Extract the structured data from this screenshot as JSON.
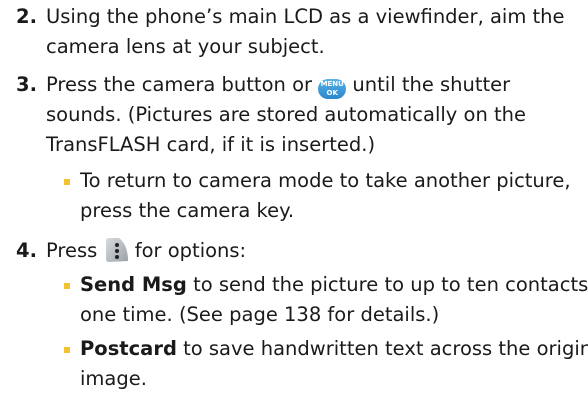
{
  "steps": [
    {
      "number": "2.",
      "lines": [
        "Using the phone’s main LCD as a viewfinder, aim the",
        "camera lens at your subject."
      ]
    },
    {
      "number": "3.",
      "line1_before": "Press the camera button or ",
      "key_label_top": "MENU",
      "key_label_bottom": "OK",
      "line1_after": " until the shutter",
      "lines": [
        "sounds. (Pictures are stored automatically on the",
        "TransFLASH card, if it is inserted.)"
      ],
      "bullets": [
        {
          "lines": [
            "To return to camera mode to take another picture,",
            "press the camera key."
          ]
        }
      ]
    },
    {
      "number": "4.",
      "line1_before": "Press ",
      "line1_after": " for options:",
      "key_icon": "options-softkey-icon",
      "bullets": [
        {
          "bold": "Send Msg",
          "rest": " to send the picture to up to ten contacts at",
          "lines": [
            "one time. (See page 138 for details.)"
          ]
        },
        {
          "bold": "Postcard",
          "rest": " to save handwritten text across the original",
          "lines": [
            "image."
          ]
        }
      ]
    }
  ],
  "colors": {
    "bullet": "#f2c230",
    "menu_key": "#2a86cc",
    "text": "#1a1a1a"
  }
}
